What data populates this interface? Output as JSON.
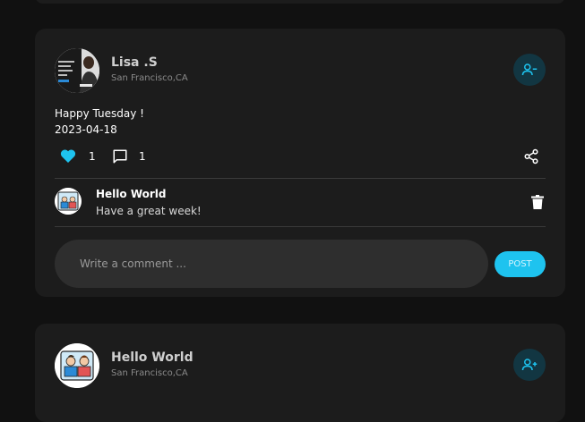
{
  "colors": {
    "background": "#111111",
    "card": "#1c1c1c",
    "accent": "#1ec3ef",
    "follow_button_bg": "#123642"
  },
  "posts": [
    {
      "author": "Lisa .S",
      "location": "San Francisco,CA",
      "follow_icon": "user-minus-icon",
      "text": "Happy Tuesday !",
      "date": "2023-04-18",
      "likes": "1",
      "comments_count": "1",
      "share_icon": "share-icon",
      "comments": [
        {
          "author": "Hello World",
          "text": "Have a great week!",
          "delete_icon": "trash-icon"
        }
      ],
      "comment_placeholder": "Write a comment ...",
      "post_button_label": "POST"
    },
    {
      "author": "Hello World",
      "location": "San Francisco,CA",
      "follow_icon": "user-plus-icon"
    }
  ]
}
